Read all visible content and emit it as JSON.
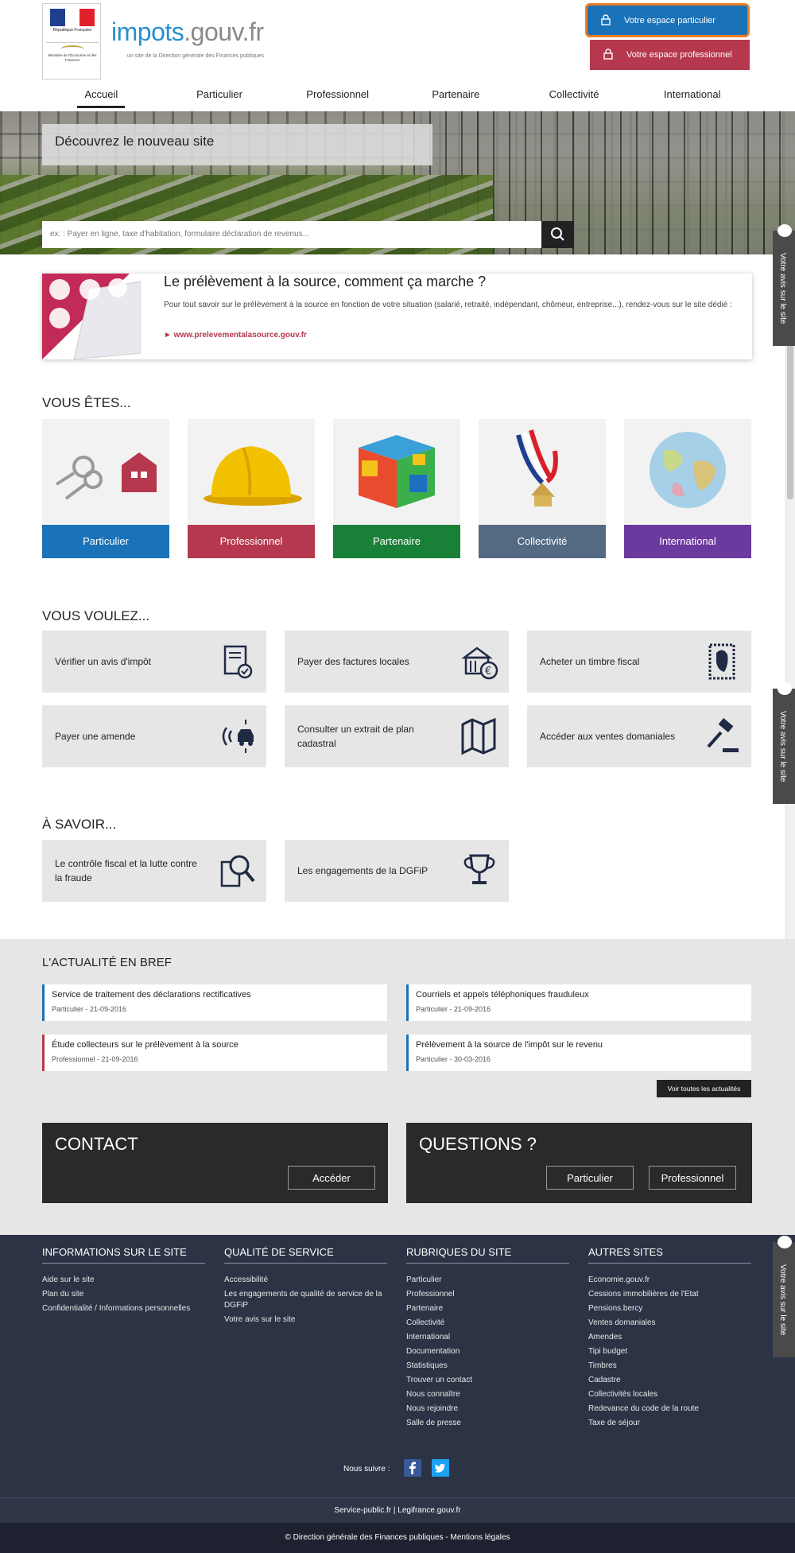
{
  "header": {
    "logo_gov_text": "République Française",
    "ministry_text": "Ministère de l'Économie et des Finances",
    "site_name_main": "impots",
    "site_name_domain": ".gouv.fr",
    "site_tagline": "un site de la Direction générale des Finances publiques",
    "btn_particulier": "Votre espace particulier",
    "btn_professionnel": "Votre espace professionnel"
  },
  "nav": [
    "Accueil",
    "Particulier",
    "Professionnel",
    "Partenaire",
    "Collectivité",
    "International"
  ],
  "hero": {
    "banner": "Découvrez le nouveau site",
    "search_placeholder": "ex. : Payer en ligne, taxe d'habitation, formulaire déclaration de revenus..."
  },
  "promo": {
    "title": "Le prélèvement à la source, comment ça marche ?",
    "text": "Pour tout savoir sur le prélèvement à la source en fonction de votre situation (salarié, retraité, indépendant, chômeur, entreprise...), rendez-vous sur le site dédié :",
    "link": "► www.prelevementalasource.gouv.fr"
  },
  "vous_etes": {
    "title": "VOUS ÊTES...",
    "profiles": [
      {
        "label": "Particulier",
        "color": "#1a72b8"
      },
      {
        "label": "Professionnel",
        "color": "#b5384e"
      },
      {
        "label": "Partenaire",
        "color": "#198038"
      },
      {
        "label": "Collectivité",
        "color": "#546a82"
      },
      {
        "label": "International",
        "color": "#6a3a9e"
      }
    ]
  },
  "vous_voulez": {
    "title": "VOUS VOULEZ...",
    "items": [
      {
        "label": "Vérifier un avis d'impôt",
        "icon": "document-check-icon"
      },
      {
        "label": "Payer des factures locales",
        "icon": "townhall-euro-icon"
      },
      {
        "label": "Acheter un timbre fiscal",
        "icon": "stamp-icon"
      },
      {
        "label": "Payer une amende",
        "icon": "speed-camera-icon"
      },
      {
        "label": "Consulter un extrait de plan cadastral",
        "icon": "map-icon"
      },
      {
        "label": "Accéder aux ventes domaniales",
        "icon": "gavel-icon"
      }
    ]
  },
  "a_savoir": {
    "title": "À SAVOIR...",
    "items": [
      {
        "label": "Le contrôle fiscal et la lutte contre la fraude",
        "icon": "magnifier-document-icon"
      },
      {
        "label": "Les engagements de la DGFiP",
        "icon": "trophy-icon"
      }
    ]
  },
  "news": {
    "title": "L'ACTUALITÉ EN BREF",
    "items": [
      {
        "title": "Service de traitement des déclarations rectificatives",
        "meta": "Particulier - 21-09-2016"
      },
      {
        "title": "Courriels et appels téléphoniques frauduleux",
        "meta": "Particulier - 21-09-2016"
      },
      {
        "title": "Étude collecteurs sur le prélèvement à la source",
        "meta": "Professionnel - 21-09-2016"
      },
      {
        "title": "Prélèvement à la source de l'impôt sur le revenu",
        "meta": "Particulier - 30-03-2016"
      }
    ],
    "all_label": "Voir toutes les actualités"
  },
  "contact": {
    "title": "CONTACT",
    "button": "Accéder"
  },
  "questions": {
    "title": "QUESTIONS ?",
    "btn_particulier": "Particulier",
    "btn_professionnel": "Professionnel"
  },
  "footer": {
    "cols": [
      {
        "title": "INFORMATIONS SUR LE SITE",
        "links": [
          "Aide sur le site",
          "Plan du site",
          "Confidentialité / Informations personnelles"
        ]
      },
      {
        "title": "QUALITÉ DE SERVICE",
        "links": [
          "Accessibilité",
          "Les engagements de qualité de service de la DGFiP",
          "Votre avis sur le site"
        ]
      },
      {
        "title": "RUBRIQUES DU SITE",
        "links": [
          "Particulier",
          "Professionnel",
          "Partenaire",
          "Collectivité",
          "International",
          "Documentation",
          "Statistiques",
          "Trouver un contact",
          "Nous connaître",
          "Nous rejoindre",
          "Salle de presse"
        ]
      },
      {
        "title": "AUTRES SITES",
        "links": [
          "Economie.gouv.fr",
          "Cessions immobilières de l'Etat",
          "Pensions.bercy",
          "Ventes domaniales",
          "Amendes",
          "Tipi budget",
          "Timbres",
          "Cadastre",
          "Collectivités locales",
          "Redevance du code de la route",
          "Taxe de séjour"
        ]
      }
    ],
    "follow_label": "Nous suivre :",
    "links_bar": "Service-public.fr | Legifrance.gouv.fr",
    "copyright": "© Direction générale des Finances publiques   -   Mentions légales"
  },
  "side_tab_label": "Votre avis sur le site",
  "colors": {
    "particulier": "#1a72b8",
    "professionnel": "#b5384e",
    "focus_ring": "#ee7d22",
    "footer_bg": "#2b3345"
  }
}
